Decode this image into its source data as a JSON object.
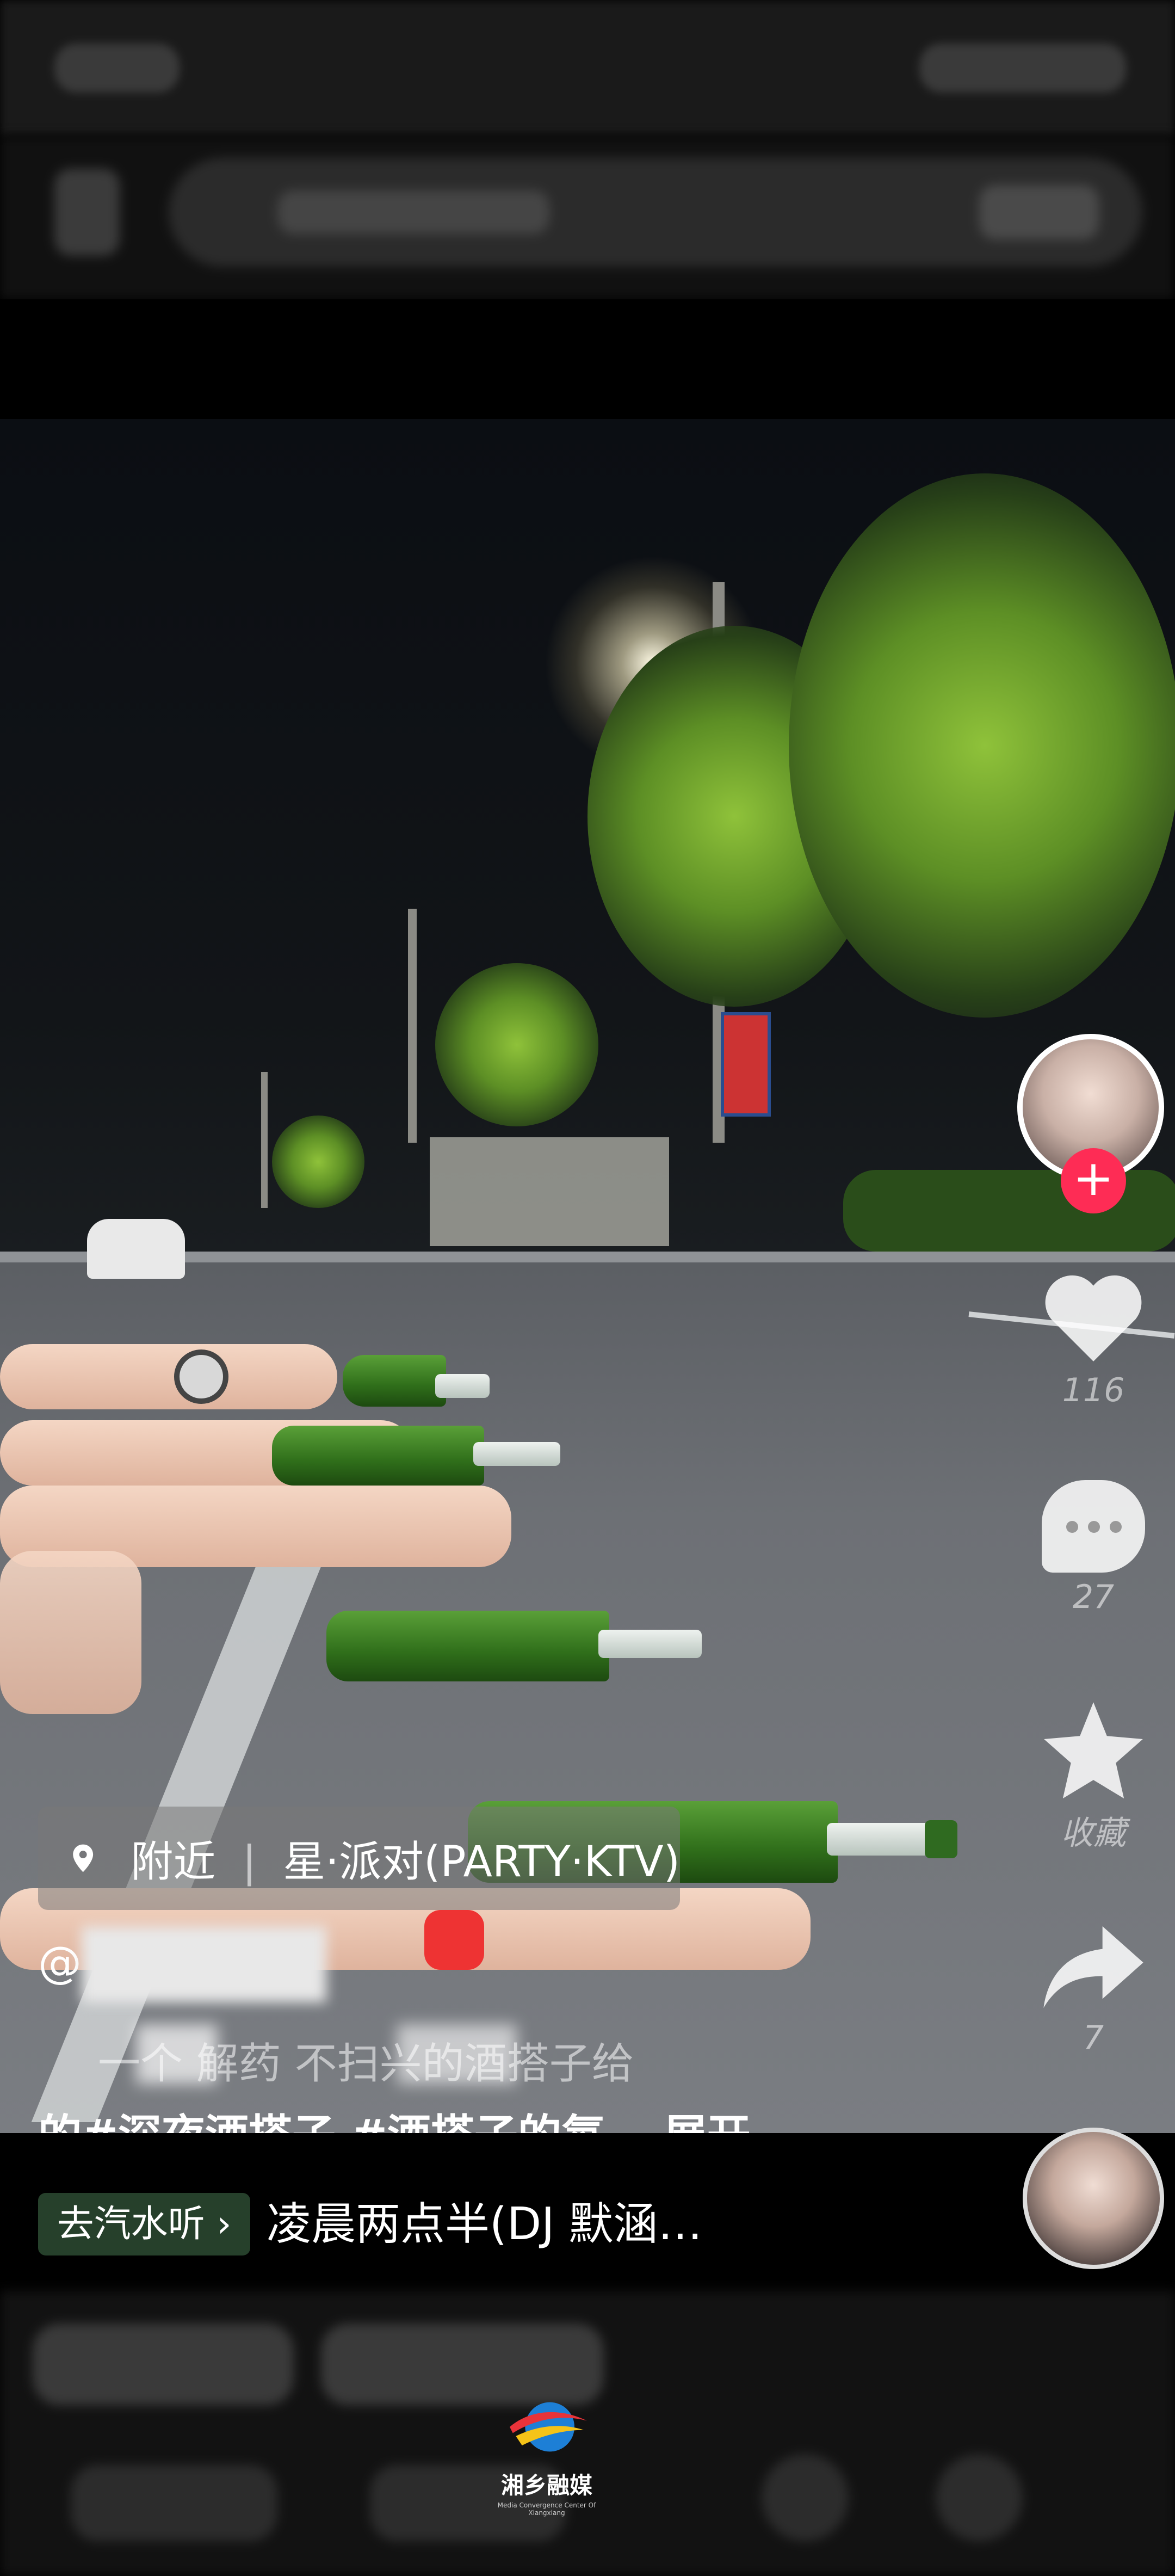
{
  "right_actions": {
    "likes": "116",
    "comments": "27",
    "favorites_label": "收藏",
    "shares": "7"
  },
  "location": {
    "prefix": "附近",
    "name": "星·派对(PARTY·KTV)"
  },
  "post": {
    "author": "@",
    "desc_line1": "一个 解药 不扫兴的酒搭子给",
    "desc_line2": "的#深夜酒搭子 #酒搭子的氛… 展开",
    "expand_icon": "chevron-down-icon"
  },
  "music": {
    "chip_label": "去汽水听 ›",
    "title": "凌晨两点半(DJ 默涵…"
  },
  "watermark": {
    "name": "湘乡融媒",
    "sub": "Media Convergence Center Of Xiangxiang"
  },
  "colors": {
    "follow": "#fe2c55",
    "music_chip": "#26402b"
  }
}
